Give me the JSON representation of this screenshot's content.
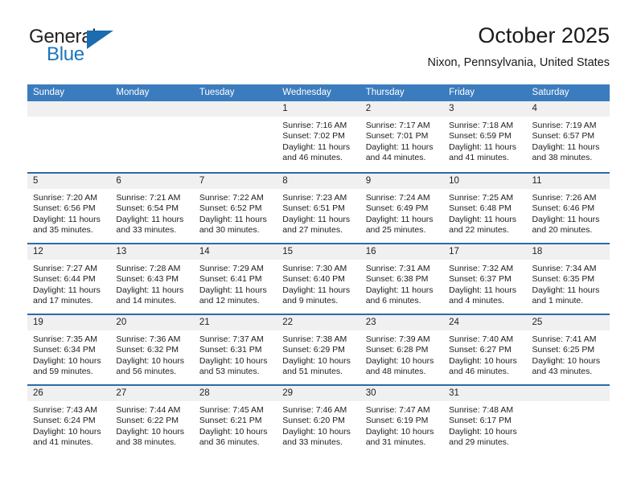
{
  "brand": {
    "name_part1": "General",
    "name_part2": "Blue",
    "triangle_icon": "blue-triangle-icon",
    "accent_color": "#1b75bb"
  },
  "header": {
    "title": "October 2025",
    "location": "Nixon, Pennsylvania, United States"
  },
  "theme": {
    "header_blue": "#3b7cbe",
    "rule_blue": "#2b6ca8",
    "date_band_gray": "#f0f0f0"
  },
  "weekdays": [
    "Sunday",
    "Monday",
    "Tuesday",
    "Wednesday",
    "Thursday",
    "Friday",
    "Saturday"
  ],
  "labels": {
    "sunrise": "Sunrise:",
    "sunset": "Sunset:",
    "daylight": "Daylight:"
  },
  "weeks": [
    [
      {
        "day": "",
        "empty": true
      },
      {
        "day": "",
        "empty": true
      },
      {
        "day": "",
        "empty": true
      },
      {
        "day": "1",
        "sunrise": "Sunrise: 7:16 AM",
        "sunset": "Sunset: 7:02 PM",
        "daylight": "Daylight: 11 hours and 46 minutes."
      },
      {
        "day": "2",
        "sunrise": "Sunrise: 7:17 AM",
        "sunset": "Sunset: 7:01 PM",
        "daylight": "Daylight: 11 hours and 44 minutes."
      },
      {
        "day": "3",
        "sunrise": "Sunrise: 7:18 AM",
        "sunset": "Sunset: 6:59 PM",
        "daylight": "Daylight: 11 hours and 41 minutes."
      },
      {
        "day": "4",
        "sunrise": "Sunrise: 7:19 AM",
        "sunset": "Sunset: 6:57 PM",
        "daylight": "Daylight: 11 hours and 38 minutes."
      }
    ],
    [
      {
        "day": "5",
        "sunrise": "Sunrise: 7:20 AM",
        "sunset": "Sunset: 6:56 PM",
        "daylight": "Daylight: 11 hours and 35 minutes."
      },
      {
        "day": "6",
        "sunrise": "Sunrise: 7:21 AM",
        "sunset": "Sunset: 6:54 PM",
        "daylight": "Daylight: 11 hours and 33 minutes."
      },
      {
        "day": "7",
        "sunrise": "Sunrise: 7:22 AM",
        "sunset": "Sunset: 6:52 PM",
        "daylight": "Daylight: 11 hours and 30 minutes."
      },
      {
        "day": "8",
        "sunrise": "Sunrise: 7:23 AM",
        "sunset": "Sunset: 6:51 PM",
        "daylight": "Daylight: 11 hours and 27 minutes."
      },
      {
        "day": "9",
        "sunrise": "Sunrise: 7:24 AM",
        "sunset": "Sunset: 6:49 PM",
        "daylight": "Daylight: 11 hours and 25 minutes."
      },
      {
        "day": "10",
        "sunrise": "Sunrise: 7:25 AM",
        "sunset": "Sunset: 6:48 PM",
        "daylight": "Daylight: 11 hours and 22 minutes."
      },
      {
        "day": "11",
        "sunrise": "Sunrise: 7:26 AM",
        "sunset": "Sunset: 6:46 PM",
        "daylight": "Daylight: 11 hours and 20 minutes."
      }
    ],
    [
      {
        "day": "12",
        "sunrise": "Sunrise: 7:27 AM",
        "sunset": "Sunset: 6:44 PM",
        "daylight": "Daylight: 11 hours and 17 minutes."
      },
      {
        "day": "13",
        "sunrise": "Sunrise: 7:28 AM",
        "sunset": "Sunset: 6:43 PM",
        "daylight": "Daylight: 11 hours and 14 minutes."
      },
      {
        "day": "14",
        "sunrise": "Sunrise: 7:29 AM",
        "sunset": "Sunset: 6:41 PM",
        "daylight": "Daylight: 11 hours and 12 minutes."
      },
      {
        "day": "15",
        "sunrise": "Sunrise: 7:30 AM",
        "sunset": "Sunset: 6:40 PM",
        "daylight": "Daylight: 11 hours and 9 minutes."
      },
      {
        "day": "16",
        "sunrise": "Sunrise: 7:31 AM",
        "sunset": "Sunset: 6:38 PM",
        "daylight": "Daylight: 11 hours and 6 minutes."
      },
      {
        "day": "17",
        "sunrise": "Sunrise: 7:32 AM",
        "sunset": "Sunset: 6:37 PM",
        "daylight": "Daylight: 11 hours and 4 minutes."
      },
      {
        "day": "18",
        "sunrise": "Sunrise: 7:34 AM",
        "sunset": "Sunset: 6:35 PM",
        "daylight": "Daylight: 11 hours and 1 minute."
      }
    ],
    [
      {
        "day": "19",
        "sunrise": "Sunrise: 7:35 AM",
        "sunset": "Sunset: 6:34 PM",
        "daylight": "Daylight: 10 hours and 59 minutes."
      },
      {
        "day": "20",
        "sunrise": "Sunrise: 7:36 AM",
        "sunset": "Sunset: 6:32 PM",
        "daylight": "Daylight: 10 hours and 56 minutes."
      },
      {
        "day": "21",
        "sunrise": "Sunrise: 7:37 AM",
        "sunset": "Sunset: 6:31 PM",
        "daylight": "Daylight: 10 hours and 53 minutes."
      },
      {
        "day": "22",
        "sunrise": "Sunrise: 7:38 AM",
        "sunset": "Sunset: 6:29 PM",
        "daylight": "Daylight: 10 hours and 51 minutes."
      },
      {
        "day": "23",
        "sunrise": "Sunrise: 7:39 AM",
        "sunset": "Sunset: 6:28 PM",
        "daylight": "Daylight: 10 hours and 48 minutes."
      },
      {
        "day": "24",
        "sunrise": "Sunrise: 7:40 AM",
        "sunset": "Sunset: 6:27 PM",
        "daylight": "Daylight: 10 hours and 46 minutes."
      },
      {
        "day": "25",
        "sunrise": "Sunrise: 7:41 AM",
        "sunset": "Sunset: 6:25 PM",
        "daylight": "Daylight: 10 hours and 43 minutes."
      }
    ],
    [
      {
        "day": "26",
        "sunrise": "Sunrise: 7:43 AM",
        "sunset": "Sunset: 6:24 PM",
        "daylight": "Daylight: 10 hours and 41 minutes."
      },
      {
        "day": "27",
        "sunrise": "Sunrise: 7:44 AM",
        "sunset": "Sunset: 6:22 PM",
        "daylight": "Daylight: 10 hours and 38 minutes."
      },
      {
        "day": "28",
        "sunrise": "Sunrise: 7:45 AM",
        "sunset": "Sunset: 6:21 PM",
        "daylight": "Daylight: 10 hours and 36 minutes."
      },
      {
        "day": "29",
        "sunrise": "Sunrise: 7:46 AM",
        "sunset": "Sunset: 6:20 PM",
        "daylight": "Daylight: 10 hours and 33 minutes."
      },
      {
        "day": "30",
        "sunrise": "Sunrise: 7:47 AM",
        "sunset": "Sunset: 6:19 PM",
        "daylight": "Daylight: 10 hours and 31 minutes."
      },
      {
        "day": "31",
        "sunrise": "Sunrise: 7:48 AM",
        "sunset": "Sunset: 6:17 PM",
        "daylight": "Daylight: 10 hours and 29 minutes."
      },
      {
        "day": "",
        "empty": true
      }
    ]
  ]
}
